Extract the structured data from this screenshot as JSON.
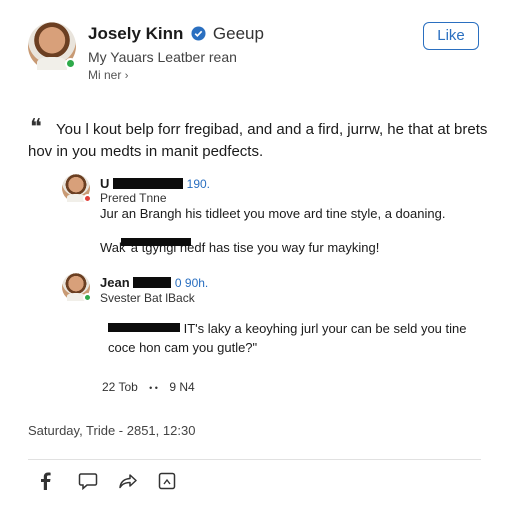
{
  "post": {
    "author_name": "Josely Kinn",
    "group_label": "Geeup",
    "subtitle": "My Yauars Leatber rean",
    "meta": "Mi ner",
    "like_button": "Like",
    "quote_mark": "❝",
    "body_line1": "You l kout belp forr fregibad, and and a fird, jurrw, he that at brets",
    "body_line2": "hov in you medts in manit pedfects.",
    "timestamp_line": "Saturday, Tride - 2851, 12:30"
  },
  "replies": [
    {
      "name_prefix": "U",
      "time": "190.",
      "role": "Prered Tnne",
      "text_line1": "Jur an Brangh his tidleet you move ard tine style, a doaning.",
      "text_line2_pre": "Wak",
      "text_line2_post": "a tgyngi hedf has tise you way fur mayking!"
    },
    {
      "name_prefix": "Jean",
      "time": "0 90h.",
      "role": "Svester Bat lBack",
      "text_line1_post": "IT's laky a keoyhing jurl your can be seld you tine",
      "text_line2": "coce hon cam you gutle?\""
    }
  ],
  "reactions": {
    "likes": "22 Tob",
    "dots": "• •",
    "count": "9 N4"
  },
  "actions": [
    {
      "icon": "facebook-icon"
    },
    {
      "icon": "comment-icon"
    },
    {
      "icon": "share-icon"
    },
    {
      "icon": "save-icon"
    }
  ]
}
